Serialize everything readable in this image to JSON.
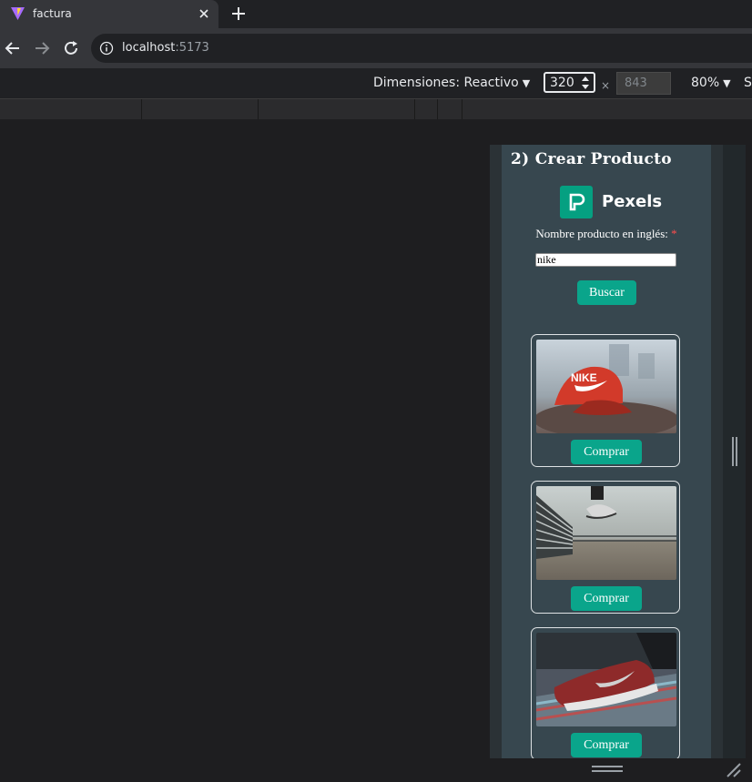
{
  "browser": {
    "tab_title": "factura",
    "url_host": "localhost",
    "url_port": ":5173"
  },
  "device_toolbar": {
    "dimensions_label": "Dimensiones: Reactivo",
    "width_value": "320",
    "times_symbol": "×",
    "height_placeholder": "843",
    "zoom_label": "80%",
    "overflow_text": "S"
  },
  "app": {
    "section_title": "2) Crear Producto",
    "logo_text": "Pexels",
    "field_label": "Nombre producto en inglés:",
    "required_mark": "*",
    "search_value": "nike",
    "search_button": "Buscar",
    "results": [
      {
        "image": "red-nike-cap-photo",
        "button": "Comprar"
      },
      {
        "image": "jumping-sneakers-photo",
        "button": "Comprar"
      },
      {
        "image": "red-nike-sneaker-photo",
        "button": "Comprar"
      }
    ]
  },
  "colors": {
    "accent": "#0aa58b",
    "card_bg": "#37474f",
    "pexels_brand": "#05a081",
    "required": "#ff4d4d"
  }
}
